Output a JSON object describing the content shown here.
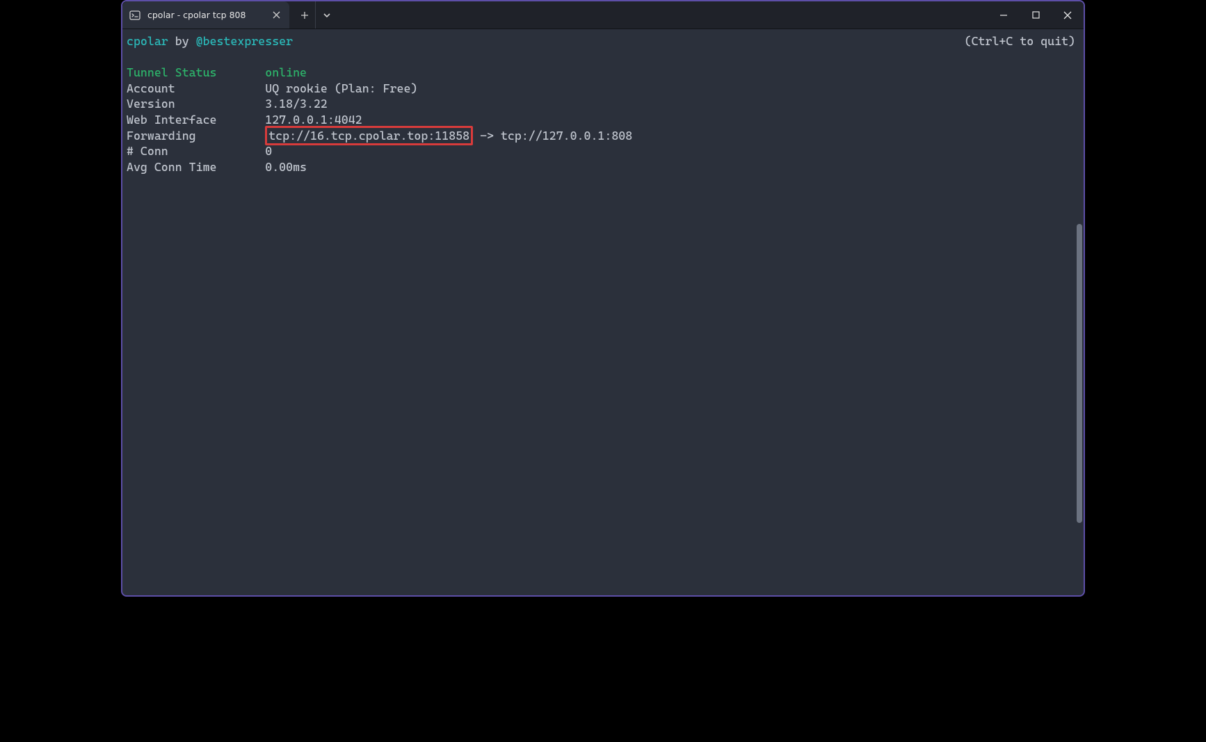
{
  "titlebar": {
    "tab_title": "cpolar - cpolar  tcp 808"
  },
  "header": {
    "app": "cpolar",
    "by": "by",
    "author": "@bestexpresser",
    "quit_hint": "(Ctrl+C to quit)"
  },
  "status": {
    "tunnel_label": "Tunnel Status",
    "tunnel_value": "online",
    "account_label": "Account",
    "account_value": "UQ rookie (Plan: Free)",
    "version_label": "Version",
    "version_value": "3.18/3.22",
    "webif_label": "Web Interface",
    "webif_value": "127.0.0.1:4042",
    "fwd_label": "Forwarding",
    "fwd_remote": "tcp://16.tcp.cpolar.top:11858",
    "fwd_arrow": "->",
    "fwd_local": "tcp://127.0.0.1:808",
    "conn_label": "# Conn",
    "conn_value": "0",
    "avg_label": "Avg Conn Time",
    "avg_value": "0.00ms"
  }
}
